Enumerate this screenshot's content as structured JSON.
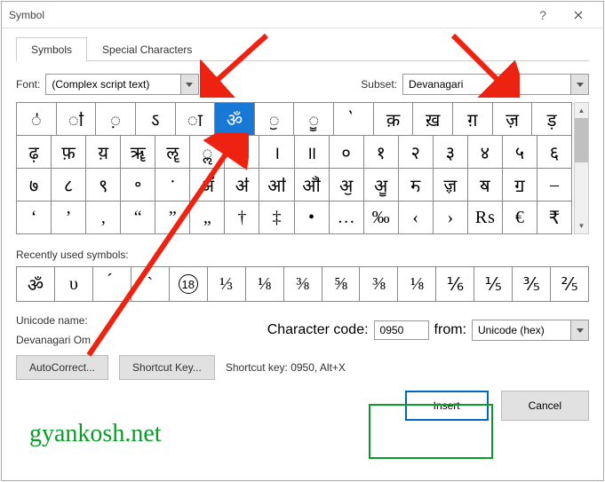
{
  "titlebar": {
    "title": "Symbol"
  },
  "tabs": {
    "symbols": "Symbols",
    "special": "Special Characters"
  },
  "font": {
    "label": "Font:",
    "value": "(Complex script text)"
  },
  "subset": {
    "label": "Subset:",
    "value": "Devanagari"
  },
  "grid": [
    [
      "ऺ",
      "ऻ",
      "़",
      "ऽ",
      "ा",
      "ॐ",
      "ॖ",
      "ॗ",
      "॓",
      "क़",
      "ख़",
      "ग़",
      "ज़",
      "ड़"
    ],
    [
      "ढ़",
      "फ़",
      "य़",
      "ॠ",
      "ॡ",
      "ॢ",
      "ॣ",
      "।",
      "॥",
      "०",
      "१",
      "२",
      "३",
      "४",
      "५",
      "६"
    ],
    [
      "७",
      "८",
      "९",
      "॰",
      "ॱ",
      "ॲ",
      "ॳ",
      "ॴ",
      "ॵ",
      "ॶ",
      "ॷ",
      "ॸ",
      "ॹ",
      "ॺ",
      "ॻ",
      "–"
    ],
    [
      "‘",
      "’",
      "‚",
      "“",
      "”",
      "„",
      "†",
      "‡",
      "•",
      "…",
      "‰",
      "‹",
      "›",
      "₨",
      "€",
      "₹"
    ]
  ],
  "recent_label": "Recently used symbols:",
  "recent": [
    "ॐ",
    "υ",
    "́",
    "`",
    "⑱",
    "⅓",
    "⅛",
    "⅜",
    "⅝",
    "⅜",
    "⅛",
    "⅙",
    "⅕",
    "⅗",
    "⅖"
  ],
  "unicode_name_label": "Unicode name:",
  "unicode_name_value": "Devanagari Om",
  "cc_label": "Character code:",
  "cc_value": "0950",
  "from_label": "from:",
  "from_value": "Unicode (hex)",
  "autocorrect_btn": "AutoCorrect...",
  "shortcutkey_btn": "Shortcut Key...",
  "shortcut_text": "Shortcut key: 0950, Alt+X",
  "insert_btn": "Insert",
  "cancel_btn": "Cancel",
  "watermark": "gyankosh.net"
}
